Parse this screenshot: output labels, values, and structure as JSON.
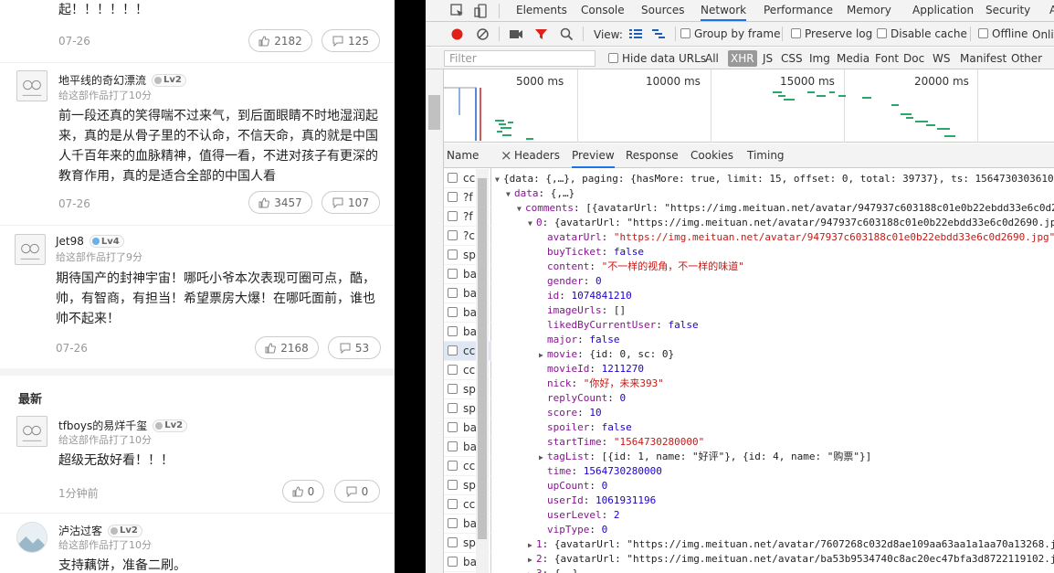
{
  "mobile": {
    "top_snippet": "起！！！！！！",
    "top_snippet_date": "07-26",
    "top_snippet_likes": "2182",
    "top_snippet_replies": "125",
    "comments": [
      {
        "name": "地平线的奇幻漂流",
        "level": "Lv2",
        "rating": "给这部作品打了10分",
        "text": "前一段还真的笑得喘不过来气，到后面眼睛不时地湿润起来，真的是从骨子里的不认命，不信天命，真的就是中国人千百年来的血脉精神，值得一看，不进对孩子有更深的教育作用，真的是适合全部的中国人看",
        "date": "07-26",
        "likes": "3457",
        "replies": "107"
      },
      {
        "name": "Jet98",
        "level": "Lv4",
        "rating": "给这部作品打了9分",
        "text": "期待国产的封神宇宙！哪吒小爷本次表现可圈可点，酷，帅，有智商，有担当！希望票房大爆！在哪吒面前，谁也帅不起来！",
        "date": "07-26",
        "likes": "2168",
        "replies": "53"
      }
    ],
    "section_latest": "最新",
    "latest": [
      {
        "name": "tfboys的易烊千玺",
        "level": "Lv2",
        "rating": "给这部作品打了10分",
        "text": "超级无敌好看！！！",
        "date": "1分钟前",
        "likes": "0",
        "replies": "0"
      },
      {
        "name": "泸沽过客",
        "level": "Lv2",
        "rating": "给这部作品打了10分",
        "text": "支持藕饼，准备二刷。"
      }
    ]
  },
  "devtools": {
    "tabs": [
      "Elements",
      "Console",
      "Sources",
      "Network",
      "Performance",
      "Memory",
      "Application",
      "Security",
      "Au"
    ],
    "active_tab": "Network",
    "toolbar": {
      "view_label": "View:",
      "group_by_frame": "Group by frame",
      "preserve_log": "Preserve log",
      "disable_cache": "Disable cache",
      "offline": "Offline",
      "online": "Onli"
    },
    "filter": {
      "placeholder": "Filter",
      "hide_data_urls": "Hide data URLs",
      "types": [
        "All",
        "XHR",
        "JS",
        "CSS",
        "Img",
        "Media",
        "Font",
        "Doc",
        "WS",
        "Manifest",
        "Other"
      ],
      "active_type": "XHR"
    },
    "overview_labels": [
      "5000 ms",
      "10000 ms",
      "15000 ms",
      "20000 ms"
    ],
    "name_header": "Name",
    "request_names": [
      "cc",
      "?f",
      "?f",
      "?c",
      "sp",
      "ba",
      "ba",
      "ba",
      "ba",
      "cc",
      "cc",
      "sp",
      "sp",
      "ba",
      "ba",
      "cc",
      "sp",
      "cc",
      "ba",
      "sp",
      "ba"
    ],
    "selected_request_index": 9,
    "panel_tabs": [
      "Headers",
      "Preview",
      "Response",
      "Cookies",
      "Timing"
    ],
    "active_panel_tab": "Preview",
    "close_symbol": "×",
    "json_lines": [
      {
        "indent": 0,
        "tri": "▼",
        "parts": [
          {
            "t": "p",
            "v": "{data: {,…}, paging: {hasMore: true, limit: 15, offset: 0, total: 39737}, ts: 1564730303610"
          }
        ]
      },
      {
        "indent": 1,
        "tri": "▼",
        "parts": [
          {
            "t": "k",
            "v": "data"
          },
          {
            "t": "p",
            "v": ": {,…}"
          }
        ]
      },
      {
        "indent": 2,
        "tri": "▼",
        "parts": [
          {
            "t": "k",
            "v": "comments"
          },
          {
            "t": "p",
            "v": ": [{avatarUrl: \"https://img.meituan.net/avatar/947937c603188c01e0b22ebdd33e6c0d2"
          }
        ]
      },
      {
        "indent": 3,
        "tri": "▼",
        "parts": [
          {
            "t": "k",
            "v": "0"
          },
          {
            "t": "p",
            "v": ": {avatarUrl: \"https://img.meituan.net/avatar/947937c603188c01e0b22ebdd33e6c0d2690.jp"
          }
        ]
      },
      {
        "indent": 4,
        "tri": "",
        "parts": [
          {
            "t": "k",
            "v": "avatarUrl"
          },
          {
            "t": "p",
            "v": ": "
          },
          {
            "t": "s",
            "v": "\"https://img.meituan.net/avatar/947937c603188c01e0b22ebdd33e6c0d2690.jpg\""
          }
        ]
      },
      {
        "indent": 4,
        "tri": "",
        "parts": [
          {
            "t": "k",
            "v": "buyTicket"
          },
          {
            "t": "p",
            "v": ": "
          },
          {
            "t": "n",
            "v": "false"
          }
        ]
      },
      {
        "indent": 4,
        "tri": "",
        "parts": [
          {
            "t": "k",
            "v": "content"
          },
          {
            "t": "p",
            "v": ": "
          },
          {
            "t": "s",
            "v": "\"不一样的视角，不一样的味道\""
          }
        ]
      },
      {
        "indent": 4,
        "tri": "",
        "parts": [
          {
            "t": "k",
            "v": "gender"
          },
          {
            "t": "p",
            "v": ": "
          },
          {
            "t": "n",
            "v": "0"
          }
        ]
      },
      {
        "indent": 4,
        "tri": "",
        "parts": [
          {
            "t": "k",
            "v": "id"
          },
          {
            "t": "p",
            "v": ": "
          },
          {
            "t": "n",
            "v": "1074841210"
          }
        ]
      },
      {
        "indent": 4,
        "tri": "",
        "parts": [
          {
            "t": "k",
            "v": "imageUrls"
          },
          {
            "t": "p",
            "v": ": []"
          }
        ]
      },
      {
        "indent": 4,
        "tri": "",
        "parts": [
          {
            "t": "k",
            "v": "likedByCurrentUser"
          },
          {
            "t": "p",
            "v": ": "
          },
          {
            "t": "n",
            "v": "false"
          }
        ]
      },
      {
        "indent": 4,
        "tri": "",
        "parts": [
          {
            "t": "k",
            "v": "major"
          },
          {
            "t": "p",
            "v": ": "
          },
          {
            "t": "n",
            "v": "false"
          }
        ]
      },
      {
        "indent": 4,
        "tri": "▶",
        "parts": [
          {
            "t": "k",
            "v": "movie"
          },
          {
            "t": "p",
            "v": ": {id: 0, sc: 0}"
          }
        ]
      },
      {
        "indent": 4,
        "tri": "",
        "parts": [
          {
            "t": "k",
            "v": "movieId"
          },
          {
            "t": "p",
            "v": ": "
          },
          {
            "t": "n",
            "v": "1211270"
          }
        ]
      },
      {
        "indent": 4,
        "tri": "",
        "parts": [
          {
            "t": "k",
            "v": "nick"
          },
          {
            "t": "p",
            "v": ": "
          },
          {
            "t": "s",
            "v": "\"你好，未来393\""
          }
        ]
      },
      {
        "indent": 4,
        "tri": "",
        "parts": [
          {
            "t": "k",
            "v": "replyCount"
          },
          {
            "t": "p",
            "v": ": "
          },
          {
            "t": "n",
            "v": "0"
          }
        ]
      },
      {
        "indent": 4,
        "tri": "",
        "parts": [
          {
            "t": "k",
            "v": "score"
          },
          {
            "t": "p",
            "v": ": "
          },
          {
            "t": "n",
            "v": "10"
          }
        ]
      },
      {
        "indent": 4,
        "tri": "",
        "parts": [
          {
            "t": "k",
            "v": "spoiler"
          },
          {
            "t": "p",
            "v": ": "
          },
          {
            "t": "n",
            "v": "false"
          }
        ]
      },
      {
        "indent": 4,
        "tri": "",
        "parts": [
          {
            "t": "k",
            "v": "startTime"
          },
          {
            "t": "p",
            "v": ": "
          },
          {
            "t": "s",
            "v": "\"1564730280000\""
          }
        ]
      },
      {
        "indent": 4,
        "tri": "▶",
        "parts": [
          {
            "t": "k",
            "v": "tagList"
          },
          {
            "t": "p",
            "v": ": [{id: 1, name: \"好评\"}, {id: 4, name: \"购票\"}]"
          }
        ]
      },
      {
        "indent": 4,
        "tri": "",
        "parts": [
          {
            "t": "k",
            "v": "time"
          },
          {
            "t": "p",
            "v": ": "
          },
          {
            "t": "n",
            "v": "1564730280000"
          }
        ]
      },
      {
        "indent": 4,
        "tri": "",
        "parts": [
          {
            "t": "k",
            "v": "upCount"
          },
          {
            "t": "p",
            "v": ": "
          },
          {
            "t": "n",
            "v": "0"
          }
        ]
      },
      {
        "indent": 4,
        "tri": "",
        "parts": [
          {
            "t": "k",
            "v": "userId"
          },
          {
            "t": "p",
            "v": ": "
          },
          {
            "t": "n",
            "v": "1061931196"
          }
        ]
      },
      {
        "indent": 4,
        "tri": "",
        "parts": [
          {
            "t": "k",
            "v": "userLevel"
          },
          {
            "t": "p",
            "v": ": "
          },
          {
            "t": "n",
            "v": "2"
          }
        ]
      },
      {
        "indent": 4,
        "tri": "",
        "parts": [
          {
            "t": "k",
            "v": "vipType"
          },
          {
            "t": "p",
            "v": ": "
          },
          {
            "t": "n",
            "v": "0"
          }
        ]
      },
      {
        "indent": 3,
        "tri": "▶",
        "parts": [
          {
            "t": "k",
            "v": "1"
          },
          {
            "t": "p",
            "v": ": {avatarUrl: \"https://img.meituan.net/avatar/7607268c032d8ae109aa63aa1a1aa70a13268.j"
          }
        ]
      },
      {
        "indent": 3,
        "tri": "▶",
        "parts": [
          {
            "t": "k",
            "v": "2"
          },
          {
            "t": "p",
            "v": ": {avatarUrl: \"https://img.meituan.net/avatar/ba53b9534740c8ac20ec47bfa3d8722119102.j"
          }
        ]
      },
      {
        "indent": 3,
        "tri": "▶",
        "parts": [
          {
            "t": "k",
            "v": "3"
          },
          {
            "t": "p",
            "v": ": {,…}"
          }
        ]
      }
    ]
  }
}
